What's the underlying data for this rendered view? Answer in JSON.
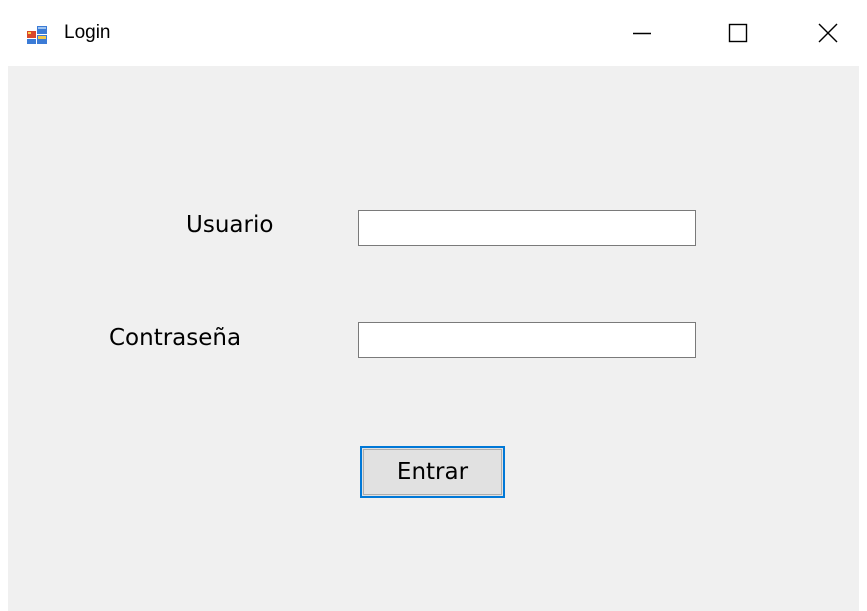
{
  "window": {
    "title": "Login",
    "controls": {
      "minimize_icon": "minimize-icon",
      "maximize_icon": "maximize-icon",
      "close_icon": "close-icon"
    }
  },
  "form": {
    "user_label": "Usuario",
    "user_value": "",
    "password_label": "Contraseña",
    "password_value": "",
    "submit_label": "Entrar"
  },
  "colors": {
    "client_background": "#f0f0f0",
    "titlebar_background": "#ffffff",
    "button_focus_border": "#0078d7",
    "button_face": "#e1e1e1",
    "field_border": "#7a7a7a"
  }
}
